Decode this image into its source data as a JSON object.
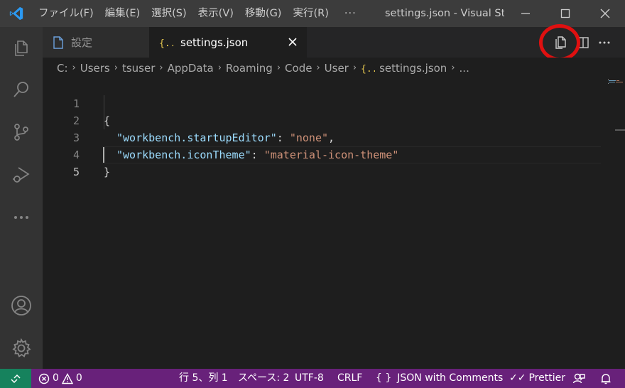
{
  "titlebar": {
    "menus": [
      "ファイル(F)",
      "編集(E)",
      "選択(S)",
      "表示(V)",
      "移動(G)",
      "実行(R)"
    ],
    "more": "···",
    "window_title": "settings.json - Visual St..."
  },
  "tabs": [
    {
      "label": "設定",
      "icon": "file-icon",
      "active": false
    },
    {
      "label": "settings.json",
      "icon": "json-braces-icon",
      "active": true
    }
  ],
  "breadcrumb": [
    "C:",
    "Users",
    "tsuser",
    "AppData",
    "Roaming",
    "Code",
    "User",
    "settings.json",
    "..."
  ],
  "editor": {
    "lines": [
      {
        "num": "1",
        "text": "{"
      },
      {
        "num": "2",
        "key": "\"workbench.startupEditor\"",
        "value": "\"none\""
      },
      {
        "num": "3",
        "key": "\"workbench.iconTheme\"",
        "value": "\"material-icon-theme\""
      },
      {
        "num": "4",
        "text": "}"
      },
      {
        "num": "5",
        "text": ""
      }
    ],
    "active_line": 5
  },
  "statusbar": {
    "errors": "0",
    "warnings": "0",
    "position": "行 5、列 1",
    "spaces": "スペース: 2",
    "encoding": "UTF-8",
    "eol": "CRLF",
    "language": "JSON with Comments",
    "formatter": "Prettier"
  },
  "colors": {
    "statusbar": "#68217a",
    "remote": "#16825d",
    "highlight_ring": "#e01010",
    "json_key": "#9cdcfe",
    "json_string": "#ce9178"
  }
}
